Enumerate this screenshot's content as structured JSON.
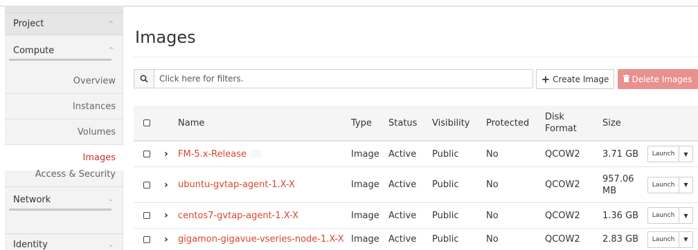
{
  "sidebar": {
    "project": {
      "label": "Project",
      "chevron": "^"
    },
    "compute": {
      "label": "Compute",
      "chevron": "^"
    },
    "items": [
      {
        "label": "Overview",
        "active": false
      },
      {
        "label": "Instances",
        "active": false
      },
      {
        "label": "Volumes",
        "active": false
      },
      {
        "label": "Images",
        "active": true
      },
      {
        "label": "Access & Security",
        "active": false
      }
    ],
    "network": {
      "label": "Network",
      "chevron": "⌄"
    },
    "identity": {
      "label": "Identity",
      "chevron": "⌄"
    }
  },
  "page": {
    "title": "Images"
  },
  "filter": {
    "placeholder": "Click here for filters.",
    "icon": "search-icon"
  },
  "toolbar": {
    "create_label": "Create Image",
    "create_icon": "+",
    "delete_label": "Delete Images",
    "delete_icon": "trash-icon",
    "delete_color": "#e8918e"
  },
  "table": {
    "columns": {
      "name": "Name",
      "type": "Type",
      "status": "Status",
      "visibility": "Visibility",
      "protected": "Protected",
      "disk_format_1": "Disk",
      "disk_format_2": "Format",
      "size": "Size"
    },
    "rows": [
      {
        "name": "FM-5.x-Release",
        "type": "Image",
        "status": "Active",
        "visibility": "Public",
        "protected": "No",
        "format": "QCOW2",
        "size_1": "3.71 GB",
        "size_2": "",
        "action": "Launch"
      },
      {
        "name": "ubuntu-gvtap-agent-1.X-X",
        "type": "Image",
        "status": "Active",
        "visibility": "Public",
        "protected": "No",
        "format": "QCOW2",
        "size_1": "957.06",
        "size_2": "MB",
        "action": "Launch"
      },
      {
        "name": "centos7-gvtap-agent-1.X-X",
        "type": "Image",
        "status": "Active",
        "visibility": "Public",
        "protected": "No",
        "format": "QCOW2",
        "size_1": "1.36 GB",
        "size_2": "",
        "action": "Launch"
      },
      {
        "name": "gigamon-gigavue-vseries-node-1.X-X",
        "type": "Image",
        "status": "Active",
        "visibility": "Public",
        "protected": "No",
        "format": "QCOW2",
        "size_1": "2.83 GB",
        "size_2": "",
        "action": "Launch"
      }
    ]
  },
  "colors": {
    "accent": "#d9452b",
    "active_nav": "#c9302c"
  }
}
